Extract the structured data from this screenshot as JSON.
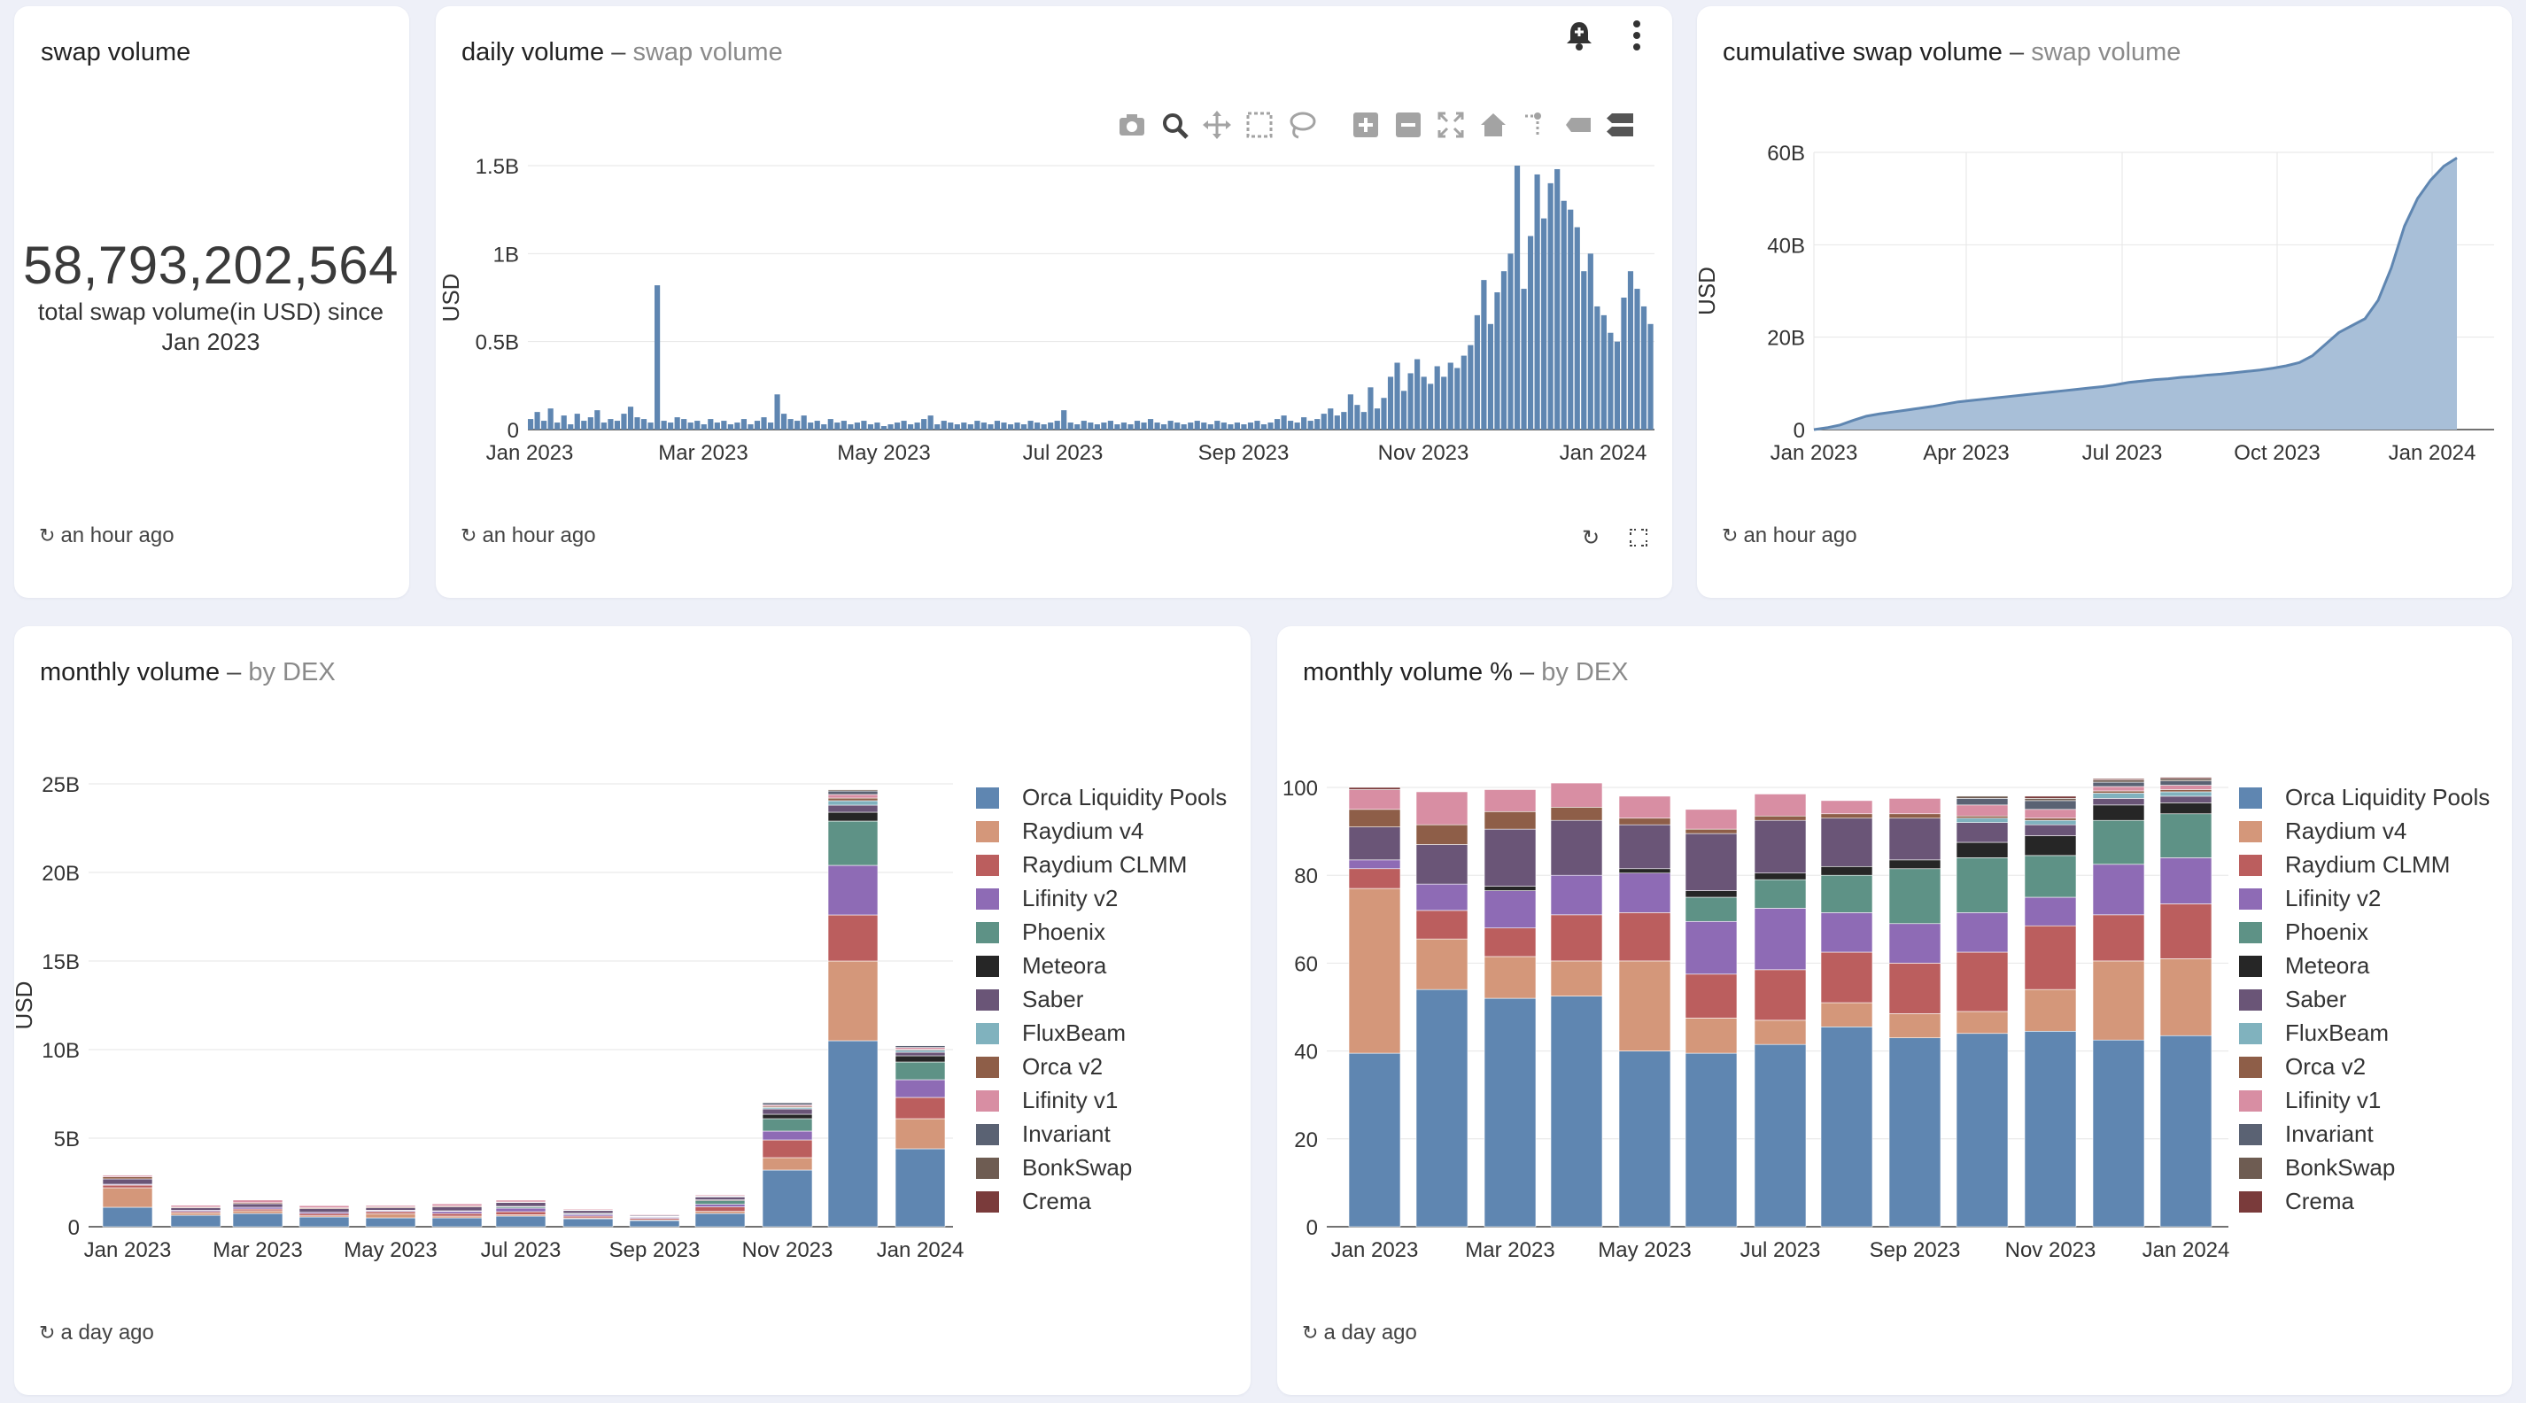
{
  "kpi": {
    "title": "swap volume",
    "value": "58,793,202,564",
    "caption": "total swap volume(in USD) since Jan 2023",
    "updated": "an hour ago"
  },
  "daily": {
    "title": "daily volume",
    "subtitle": "swap volume",
    "updated": "an hour ago",
    "y_label": "USD",
    "toolbar": [
      "camera-icon",
      "zoom-icon",
      "pan-icon",
      "box-select-icon",
      "lasso-icon",
      "zoom-in-icon",
      "zoom-out-icon",
      "autoscale-icon",
      "reset-axes-icon",
      "spike-lines-icon",
      "hover-closest-icon",
      "hover-compare-icon"
    ]
  },
  "cumulative": {
    "title": "cumulative swap volume",
    "subtitle": "swap volume",
    "updated": "an hour ago",
    "y_label": "USD"
  },
  "monthly": {
    "title": "monthly volume",
    "subtitle": "by DEX",
    "updated": "a day ago",
    "y_label": "USD"
  },
  "monthly_pct": {
    "title": "monthly volume %",
    "subtitle": "by DEX",
    "updated": "a day ago"
  },
  "colors": {
    "Orca Liquidity Pools": "#5f86b1",
    "Raydium v4": "#d4977a",
    "Raydium CLMM": "#bb5e5e",
    "Lifinity v2": "#8e6bb5",
    "Phoenix": "#5e9286",
    "Meteora": "#262626",
    "Saber": "#6a5577",
    "FluxBeam": "#80b2be",
    "Orca v2": "#8e5e48",
    "Lifinity v1": "#d88ea3",
    "Invariant": "#5a6273",
    "BonkSwap": "#6e5c52",
    "Crema": "#7a3b3b"
  },
  "chart_data": [
    {
      "id": "daily",
      "type": "area",
      "title": "daily volume",
      "ylabel": "USD",
      "ylim": [
        0,
        1.5
      ],
      "y_unit": "B",
      "y_ticks": [
        "0",
        "0.5B",
        "1B",
        "1.5B"
      ],
      "x_ticks": [
        "Jan 2023",
        "Mar 2023",
        "May 2023",
        "Jul 2023",
        "Sep 2023",
        "Nov 2023",
        "Jan 2024"
      ],
      "series": [
        {
          "values": [
            0.06,
            0.1,
            0.05,
            0.12,
            0.04,
            0.08,
            0.03,
            0.09,
            0.05,
            0.07,
            0.11,
            0.04,
            0.06,
            0.05,
            0.09,
            0.13,
            0.07,
            0.06,
            0.04,
            0.82,
            0.05,
            0.04,
            0.07,
            0.06,
            0.04,
            0.05,
            0.03,
            0.06,
            0.04,
            0.05,
            0.03,
            0.04,
            0.06,
            0.03,
            0.05,
            0.07,
            0.04,
            0.2,
            0.09,
            0.06,
            0.05,
            0.08,
            0.04,
            0.05,
            0.03,
            0.06,
            0.04,
            0.05,
            0.03,
            0.04,
            0.05,
            0.03,
            0.04,
            0.02,
            0.03,
            0.04,
            0.05,
            0.03,
            0.04,
            0.06,
            0.08,
            0.03,
            0.05,
            0.04,
            0.03,
            0.04,
            0.03,
            0.05,
            0.04,
            0.03,
            0.05,
            0.04,
            0.03,
            0.04,
            0.03,
            0.05,
            0.04,
            0.03,
            0.04,
            0.05,
            0.11,
            0.04,
            0.03,
            0.05,
            0.04,
            0.03,
            0.04,
            0.05,
            0.03,
            0.04,
            0.03,
            0.05,
            0.04,
            0.06,
            0.04,
            0.03,
            0.05,
            0.04,
            0.03,
            0.04,
            0.05,
            0.04,
            0.03,
            0.05,
            0.04,
            0.03,
            0.04,
            0.03,
            0.04,
            0.05,
            0.03,
            0.04,
            0.06,
            0.08,
            0.05,
            0.04,
            0.07,
            0.05,
            0.06,
            0.09,
            0.12,
            0.08,
            0.1,
            0.2,
            0.14,
            0.1,
            0.24,
            0.12,
            0.18,
            0.3,
            0.38,
            0.22,
            0.32,
            0.4,
            0.3,
            0.26,
            0.36,
            0.3,
            0.38,
            0.35,
            0.42,
            0.48,
            0.65,
            0.85,
            0.6,
            0.78,
            0.9,
            1.0,
            1.55,
            0.8,
            1.1,
            1.45,
            1.2,
            1.4,
            1.48,
            1.3,
            1.25,
            1.15,
            0.9,
            1.0,
            0.7,
            0.65,
            0.55,
            0.5,
            0.75,
            0.9,
            0.8,
            0.7,
            0.6
          ]
        }
      ]
    },
    {
      "id": "cumulative",
      "type": "area",
      "title": "cumulative swap volume",
      "ylabel": "USD",
      "ylim": [
        0,
        60
      ],
      "y_unit": "B",
      "y_ticks": [
        "0",
        "20B",
        "40B",
        "60B"
      ],
      "x_ticks": [
        "Jan 2023",
        "Apr 2023",
        "Jul 2023",
        "Oct 2023",
        "Jan 2024"
      ],
      "series": [
        {
          "values": [
            0,
            0.4,
            1.0,
            2.0,
            2.9,
            3.4,
            3.8,
            4.2,
            4.6,
            5.0,
            5.5,
            6.0,
            6.3,
            6.6,
            6.9,
            7.2,
            7.5,
            7.8,
            8.1,
            8.4,
            8.7,
            9.0,
            9.3,
            9.7,
            10.2,
            10.5,
            10.8,
            11.0,
            11.3,
            11.5,
            11.8,
            12.0,
            12.3,
            12.6,
            12.9,
            13.3,
            13.8,
            14.5,
            16.0,
            18.5,
            21.0,
            22.5,
            24.0,
            28.0,
            35.0,
            44.0,
            50.0,
            54.0,
            57.0,
            58.8
          ]
        }
      ]
    },
    {
      "id": "monthly",
      "type": "bar",
      "stacked": true,
      "title": "monthly volume",
      "ylabel": "USD",
      "ylim": [
        0,
        25
      ],
      "y_unit": "B",
      "y_ticks": [
        "0",
        "5B",
        "10B",
        "15B",
        "20B",
        "25B"
      ],
      "x_ticks": [
        "Jan 2023",
        "Mar 2023",
        "May 2023",
        "Jul 2023",
        "Sep 2023",
        "Nov 2023",
        "Jan 2024"
      ],
      "categories": [
        "Jan 2023",
        "Feb 2023",
        "Mar 2023",
        "Apr 2023",
        "May 2023",
        "Jun 2023",
        "Jul 2023",
        "Aug 2023",
        "Sep 2023",
        "Oct 2023",
        "Nov 2023",
        "Dec 2023",
        "Jan 2024"
      ],
      "series": [
        {
          "name": "Orca Liquidity Pools",
          "values": [
            1.1,
            0.65,
            0.75,
            0.55,
            0.5,
            0.5,
            0.6,
            0.45,
            0.35,
            0.75,
            3.2,
            10.5,
            4.4
          ]
        },
        {
          "name": "Raydium v4",
          "values": [
            1.1,
            0.13,
            0.15,
            0.07,
            0.23,
            0.1,
            0.08,
            0.05,
            0.04,
            0.12,
            0.7,
            4.5,
            1.7
          ]
        },
        {
          "name": "Raydium CLMM",
          "values": [
            0.15,
            0.08,
            0.1,
            0.12,
            0.12,
            0.15,
            0.17,
            0.1,
            0.08,
            0.25,
            1.0,
            2.6,
            1.2
          ]
        },
        {
          "name": "Lifinity v2",
          "values": [
            0.05,
            0.07,
            0.1,
            0.08,
            0.07,
            0.12,
            0.2,
            0.09,
            0.06,
            0.15,
            0.5,
            2.8,
            1.0
          ]
        },
        {
          "name": "Phoenix",
          "values": [
            0.0,
            0.0,
            0.0,
            0.0,
            0.0,
            0.03,
            0.09,
            0.06,
            0.05,
            0.2,
            0.7,
            2.5,
            1.0
          ]
        },
        {
          "name": "Meteora",
          "values": [
            0.0,
            0.0,
            0.0,
            0.0,
            0.01,
            0.0,
            0.01,
            0.01,
            0.01,
            0.05,
            0.25,
            0.5,
            0.35
          ]
        },
        {
          "name": "Saber",
          "values": [
            0.3,
            0.14,
            0.2,
            0.2,
            0.14,
            0.22,
            0.22,
            0.16,
            0.07,
            0.17,
            0.3,
            0.4,
            0.2
          ]
        },
        {
          "name": "FluxBeam",
          "values": [
            0.0,
            0.0,
            0.0,
            0.0,
            0.0,
            0.0,
            0.0,
            0.0,
            0.0,
            0.02,
            0.08,
            0.25,
            0.12
          ]
        },
        {
          "name": "Orca v2",
          "values": [
            0.12,
            0.04,
            0.06,
            0.05,
            0.05,
            0.05,
            0.03,
            0.02,
            0.01,
            0.02,
            0.07,
            0.15,
            0.05
          ]
        },
        {
          "name": "Lifinity v1",
          "values": [
            0.1,
            0.1,
            0.15,
            0.12,
            0.08,
            0.12,
            0.1,
            0.05,
            0.04,
            0.06,
            0.08,
            0.2,
            0.1
          ]
        },
        {
          "name": "Invariant",
          "values": [
            0.0,
            0.0,
            0.0,
            0.0,
            0.0,
            0.0,
            0.0,
            0.0,
            0.0,
            0.03,
            0.12,
            0.2,
            0.1
          ]
        },
        {
          "name": "BonkSwap",
          "values": [
            0.0,
            0.0,
            0.0,
            0.0,
            0.0,
            0.0,
            0.0,
            0.0,
            0.0,
            0.02,
            0.03,
            0.08,
            0.04
          ]
        },
        {
          "name": "Crema",
          "values": [
            0.01,
            0.0,
            0.0,
            0.0,
            0.0,
            0.0,
            0.0,
            0.0,
            0.0,
            0.0,
            0.02,
            0.02,
            0.01
          ]
        }
      ]
    },
    {
      "id": "monthly_pct",
      "type": "bar",
      "stacked": true,
      "title": "monthly volume %",
      "ylim": [
        0,
        100
      ],
      "y_ticks": [
        "0",
        "20",
        "40",
        "60",
        "80",
        "100"
      ],
      "x_ticks": [
        "Jan 2023",
        "Mar 2023",
        "May 2023",
        "Jul 2023",
        "Sep 2023",
        "Nov 2023",
        "Jan 2024"
      ],
      "categories": [
        "Jan 2023",
        "Feb 2023",
        "Mar 2023",
        "Apr 2023",
        "May 2023",
        "Jun 2023",
        "Jul 2023",
        "Aug 2023",
        "Sep 2023",
        "Oct 2023",
        "Nov 2023",
        "Dec 2023",
        "Jan 2024"
      ],
      "series": [
        {
          "name": "Orca Liquidity Pools",
          "values": [
            39.5,
            54,
            52,
            52.5,
            40,
            39.5,
            41.5,
            45.5,
            43,
            44,
            44.5,
            42.5,
            43.5
          ]
        },
        {
          "name": "Raydium v4",
          "values": [
            37.5,
            11.5,
            9.5,
            8,
            20.5,
            8,
            5.5,
            5.5,
            5.5,
            5,
            9.5,
            18,
            17.5
          ]
        },
        {
          "name": "Raydium CLMM",
          "values": [
            4.5,
            6.5,
            6.5,
            10.5,
            11,
            10,
            11.5,
            11.5,
            11.5,
            13.5,
            14.5,
            10.5,
            12.5
          ]
        },
        {
          "name": "Lifinity v2",
          "values": [
            2,
            6,
            8.5,
            9,
            9,
            12,
            14,
            9,
            9,
            9,
            6.5,
            11.5,
            10.5
          ]
        },
        {
          "name": "Phoenix",
          "values": [
            0,
            0,
            0,
            0,
            0,
            5.5,
            6.5,
            8.5,
            12.5,
            12.5,
            9.5,
            10,
            10
          ]
        },
        {
          "name": "Meteora",
          "values": [
            0,
            0,
            1,
            0,
            1,
            1.5,
            1.5,
            2,
            2,
            3.5,
            4.5,
            3.5,
            2.5
          ]
        },
        {
          "name": "Saber",
          "values": [
            7.5,
            9,
            13,
            12.5,
            10,
            13,
            12,
            11,
            9.5,
            4.5,
            2.5,
            1.5,
            1.5
          ]
        },
        {
          "name": "FluxBeam",
          "values": [
            0,
            0,
            0,
            0,
            0,
            0,
            0,
            0,
            0,
            1,
            1,
            1.2,
            1
          ]
        },
        {
          "name": "Orca v2",
          "values": [
            4,
            4.5,
            4,
            3,
            1.5,
            1,
            1,
            1,
            1,
            0.5,
            0.5,
            0.5,
            0.5
          ]
        },
        {
          "name": "Lifinity v1",
          "values": [
            4.5,
            7.5,
            5,
            5.5,
            5,
            4.5,
            5,
            3,
            3.5,
            2.5,
            2,
            1,
            1
          ]
        },
        {
          "name": "Invariant",
          "values": [
            0,
            0,
            0,
            0,
            0,
            0,
            0,
            0,
            0,
            1.5,
            2,
            1,
            1
          ]
        },
        {
          "name": "BonkSwap",
          "values": [
            0,
            0,
            0,
            0,
            0,
            0,
            0,
            0,
            0,
            0.5,
            0.5,
            0.5,
            0.5
          ]
        },
        {
          "name": "Crema",
          "values": [
            0.5,
            0,
            0,
            0,
            0,
            0,
            0,
            0,
            0,
            0,
            0.5,
            0.3,
            0.3
          ]
        }
      ]
    }
  ]
}
